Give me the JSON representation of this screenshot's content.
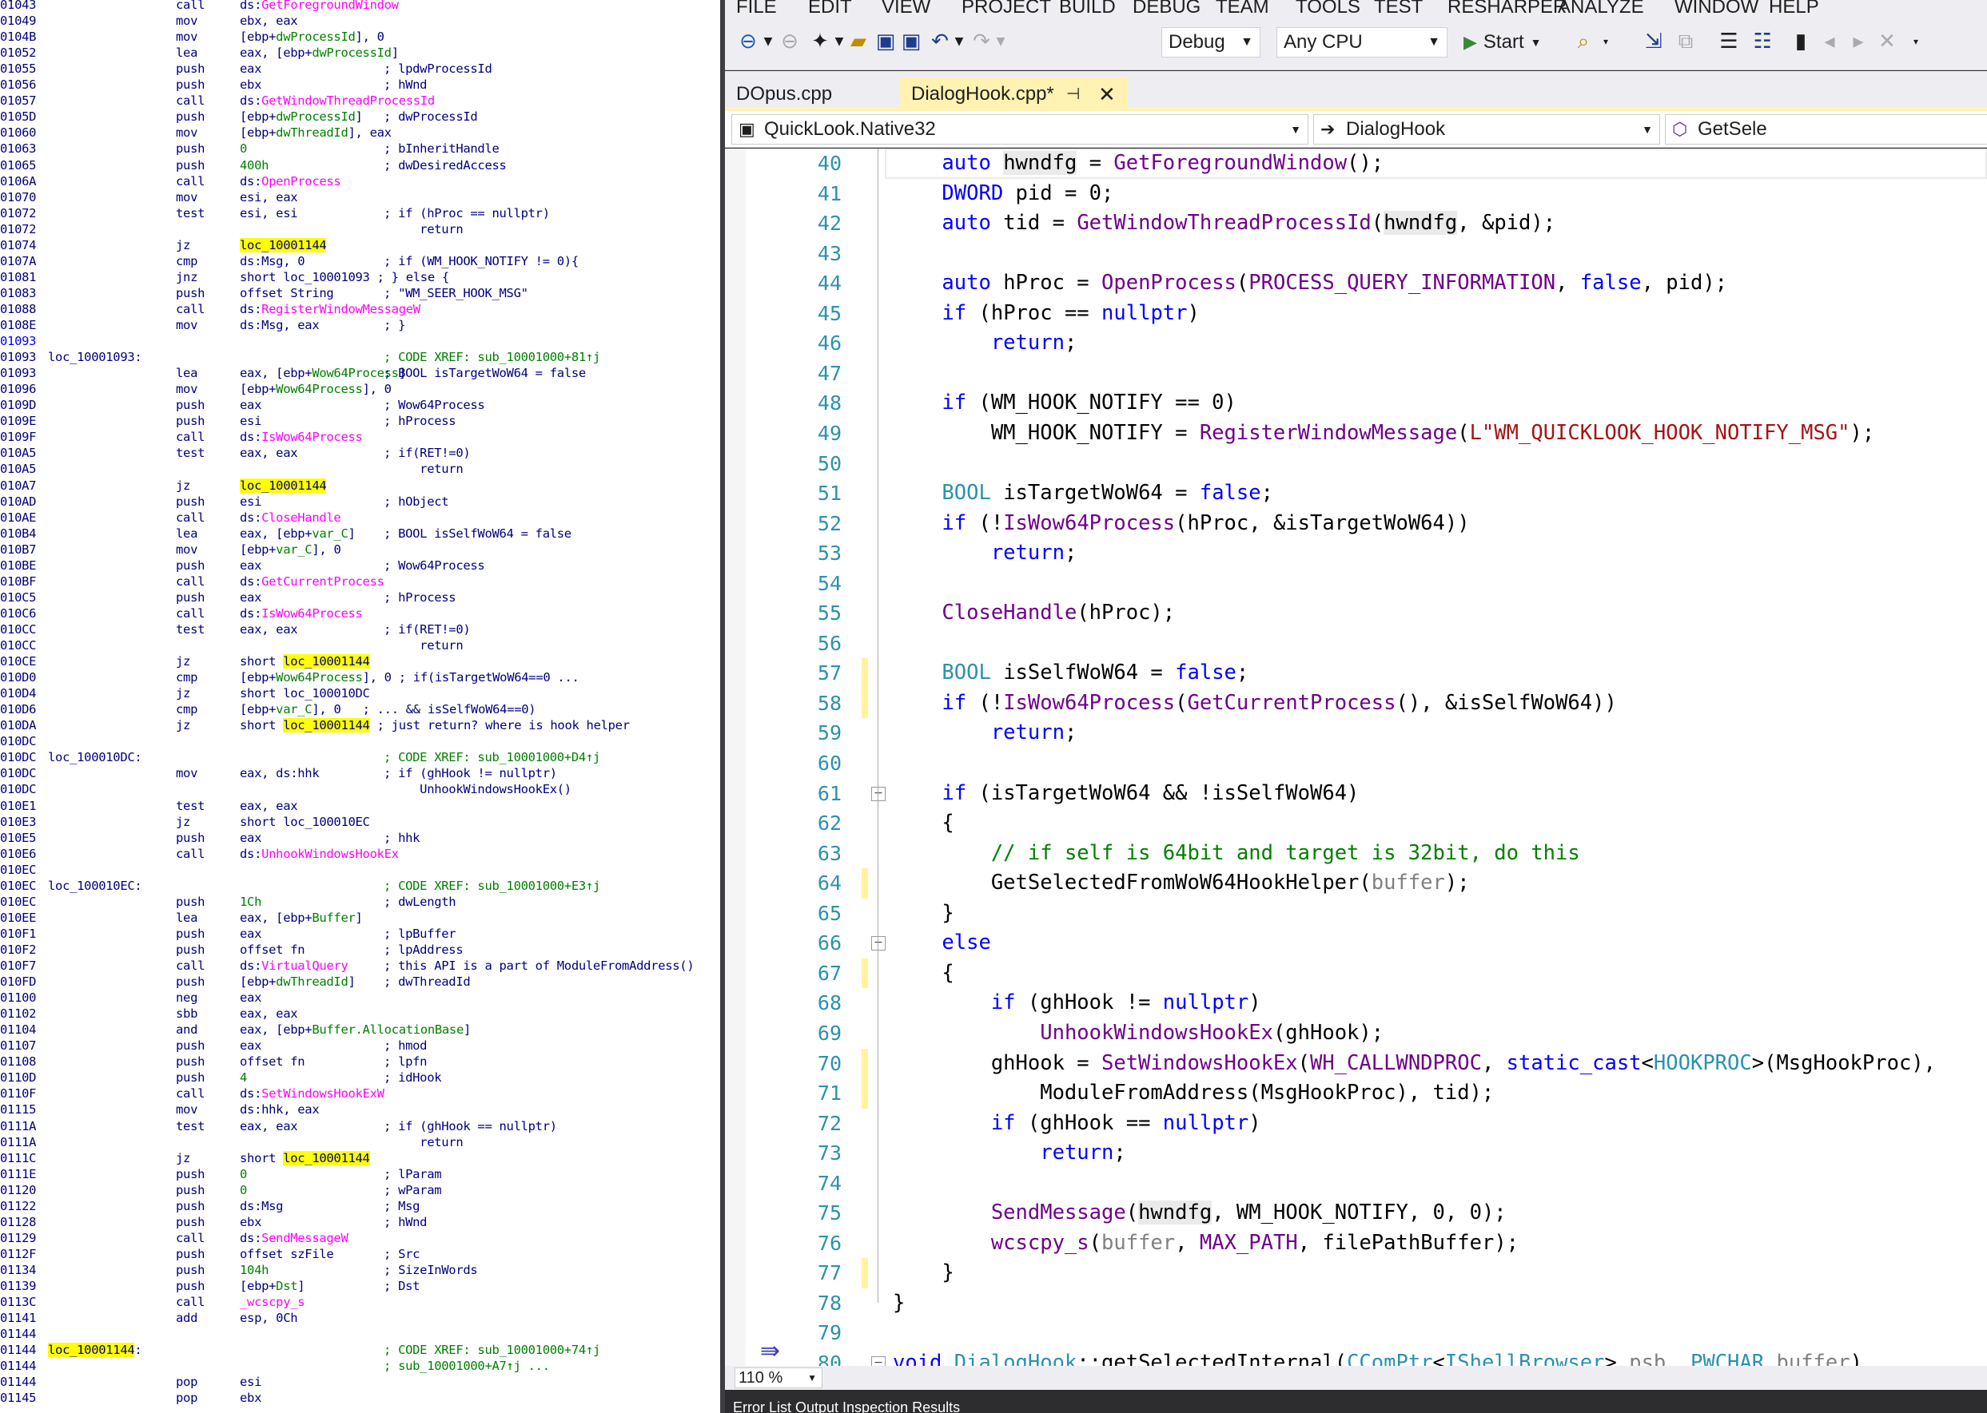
{
  "disasm": [
    [
      "01043",
      "",
      "call",
      "ds:GetForegroundWindow",
      "",
      "api"
    ],
    [
      "01049",
      "",
      "mov",
      "ebx, eax",
      "",
      ""
    ],
    [
      "0104B",
      "",
      "mov",
      "[ebp+dwProcessId], 0",
      "",
      "var"
    ],
    [
      "01052",
      "",
      "lea",
      "eax, [ebp+dwProcessId]",
      "",
      "var"
    ],
    [
      "01055",
      "",
      "push",
      "eax",
      "; lpdwProcessId",
      ""
    ],
    [
      "01056",
      "",
      "push",
      "ebx",
      "; hWnd",
      ""
    ],
    [
      "01057",
      "",
      "call",
      "ds:GetWindowThreadProcessId",
      "",
      "api"
    ],
    [
      "0105D",
      "",
      "push",
      "[ebp+dwProcessId]",
      "; dwProcessId",
      "var"
    ],
    [
      "01060",
      "",
      "mov",
      "[ebp+dwThreadId], eax",
      "",
      "var"
    ],
    [
      "01063",
      "",
      "push",
      "0",
      "; bInheritHandle",
      "num"
    ],
    [
      "01065",
      "",
      "push",
      "400h",
      "; dwDesiredAccess",
      "num"
    ],
    [
      "0106A",
      "",
      "call",
      "ds:OpenProcess",
      "",
      "api"
    ],
    [
      "01070",
      "",
      "mov",
      "esi, eax",
      "",
      ""
    ],
    [
      "01072",
      "",
      "test",
      "esi, esi",
      "; if (hProc == nullptr)",
      ""
    ],
    [
      "01072",
      "",
      "",
      "",
      "     return",
      ""
    ],
    [
      "01074",
      "",
      "jz",
      "loc_10001144",
      "",
      "loc"
    ],
    [
      "0107A",
      "",
      "cmp",
      "ds:Msg, 0",
      "; if (WM_HOOK_NOTIFY != 0){",
      ""
    ],
    [
      "01081",
      "",
      "jnz",
      "short loc_10001093 ; } else {",
      "",
      ""
    ],
    [
      "01083",
      "",
      "push",
      "offset String",
      "; \"WM_SEER_HOOK_MSG\"",
      ""
    ],
    [
      "01088",
      "",
      "call",
      "ds:RegisterWindowMessageW",
      "",
      "api"
    ],
    [
      "0108E",
      "",
      "mov",
      "ds:Msg, eax",
      "; }",
      ""
    ],
    [
      "01093",
      "",
      "",
      "",
      "",
      ""
    ],
    [
      "01093",
      "loc_10001093:",
      "",
      "",
      "; CODE XREF: sub_10001000+81↑j",
      ""
    ],
    [
      "01093",
      "",
      "lea",
      "eax, [ebp+Wow64Process]",
      "; BOOL isTargetWoW64 = false",
      "var"
    ],
    [
      "01096",
      "",
      "mov",
      "[ebp+Wow64Process], 0",
      "",
      "var"
    ],
    [
      "0109D",
      "",
      "push",
      "eax",
      "; Wow64Process",
      ""
    ],
    [
      "0109E",
      "",
      "push",
      "esi",
      "; hProcess",
      ""
    ],
    [
      "0109F",
      "",
      "call",
      "ds:IsWow64Process",
      "",
      "api"
    ],
    [
      "010A5",
      "",
      "test",
      "eax, eax",
      "; if(RET!=0)",
      ""
    ],
    [
      "010A5",
      "",
      "",
      "",
      "     return",
      ""
    ],
    [
      "010A7",
      "",
      "jz",
      "loc_10001144",
      "",
      "loc"
    ],
    [
      "010AD",
      "",
      "push",
      "esi",
      "; hObject",
      ""
    ],
    [
      "010AE",
      "",
      "call",
      "ds:CloseHandle",
      "",
      "api"
    ],
    [
      "010B4",
      "",
      "lea",
      "eax, [ebp+var_C]",
      "; BOOL isSelfWoW64 = false",
      "var"
    ],
    [
      "010B7",
      "",
      "mov",
      "[ebp+var_C], 0",
      "",
      "var"
    ],
    [
      "010BE",
      "",
      "push",
      "eax",
      "; Wow64Process",
      ""
    ],
    [
      "010BF",
      "",
      "call",
      "ds:GetCurrentProcess",
      "",
      "api"
    ],
    [
      "010C5",
      "",
      "push",
      "eax",
      "; hProcess",
      ""
    ],
    [
      "010C6",
      "",
      "call",
      "ds:IsWow64Process",
      "",
      "api"
    ],
    [
      "010CC",
      "",
      "test",
      "eax, eax",
      "; if(RET!=0)",
      ""
    ],
    [
      "010CC",
      "",
      "",
      "",
      "     return",
      ""
    ],
    [
      "010CE",
      "",
      "jz",
      "short loc_10001144",
      "",
      "sloc"
    ],
    [
      "010D0",
      "",
      "cmp",
      "[ebp+Wow64Process], 0 ; if(isTargetWoW64==0 ...",
      "",
      "var"
    ],
    [
      "010D4",
      "",
      "jz",
      "short loc_100010DC",
      "",
      ""
    ],
    [
      "010D6",
      "",
      "cmp",
      "[ebp+var_C], 0   ; ... && isSelfWoW64==0)",
      "",
      "var"
    ],
    [
      "010DA",
      "",
      "jz",
      "short loc_10001144 ; just return? where is hook helper",
      "",
      "sloc"
    ],
    [
      "010DC",
      "",
      "",
      "",
      "",
      ""
    ],
    [
      "010DC",
      "loc_100010DC:",
      "",
      "",
      "; CODE XREF: sub_10001000+D4↑j",
      ""
    ],
    [
      "010DC",
      "",
      "mov",
      "eax, ds:hhk",
      "; if (ghHook != nullptr)",
      ""
    ],
    [
      "010DC",
      "",
      "",
      "",
      "     UnhookWindowsHookEx()",
      ""
    ],
    [
      "010E1",
      "",
      "test",
      "eax, eax",
      "",
      ""
    ],
    [
      "010E3",
      "",
      "jz",
      "short loc_100010EC",
      "",
      ""
    ],
    [
      "010E5",
      "",
      "push",
      "eax",
      "; hhk",
      ""
    ],
    [
      "010E6",
      "",
      "call",
      "ds:UnhookWindowsHookEx",
      "",
      "api"
    ],
    [
      "010EC",
      "",
      "",
      "",
      "",
      ""
    ],
    [
      "010EC",
      "loc_100010EC:",
      "",
      "",
      "; CODE XREF: sub_10001000+E3↑j",
      ""
    ],
    [
      "010EC",
      "",
      "push",
      "1Ch",
      "; dwLength",
      "num"
    ],
    [
      "010EE",
      "",
      "lea",
      "eax, [ebp+Buffer]",
      "",
      "var"
    ],
    [
      "010F1",
      "",
      "push",
      "eax",
      "; lpBuffer",
      ""
    ],
    [
      "010F2",
      "",
      "push",
      "offset fn",
      "; lpAddress",
      ""
    ],
    [
      "010F7",
      "",
      "call",
      "ds:VirtualQuery",
      "; this API is a part of ModuleFromAddress()",
      "api"
    ],
    [
      "010FD",
      "",
      "push",
      "[ebp+dwThreadId]",
      "; dwThreadId",
      "var"
    ],
    [
      "01100",
      "",
      "neg",
      "eax",
      "",
      ""
    ],
    [
      "01102",
      "",
      "sbb",
      "eax, eax",
      "",
      ""
    ],
    [
      "01104",
      "",
      "and",
      "eax, [ebp+Buffer.AllocationBase]",
      "",
      "var"
    ],
    [
      "01107",
      "",
      "push",
      "eax",
      "; hmod",
      ""
    ],
    [
      "01108",
      "",
      "push",
      "offset fn",
      "; lpfn",
      ""
    ],
    [
      "0110D",
      "",
      "push",
      "4",
      "; idHook",
      "num"
    ],
    [
      "0110F",
      "",
      "call",
      "ds:SetWindowsHookExW",
      "",
      "api"
    ],
    [
      "01115",
      "",
      "mov",
      "ds:hhk, eax",
      "",
      ""
    ],
    [
      "0111A",
      "",
      "test",
      "eax, eax",
      "; if (ghHook == nullptr)",
      ""
    ],
    [
      "0111A",
      "",
      "",
      "",
      "     return",
      ""
    ],
    [
      "0111C",
      "",
      "jz",
      "short loc_10001144",
      "",
      "sloc"
    ],
    [
      "0111E",
      "",
      "push",
      "0",
      "; lParam",
      "num"
    ],
    [
      "01120",
      "",
      "push",
      "0",
      "; wParam",
      "num"
    ],
    [
      "01122",
      "",
      "push",
      "ds:Msg",
      "; Msg",
      ""
    ],
    [
      "01128",
      "",
      "push",
      "ebx",
      "; hWnd",
      ""
    ],
    [
      "01129",
      "",
      "call",
      "ds:SendMessageW",
      "",
      "api"
    ],
    [
      "0112F",
      "",
      "push",
      "offset szFile",
      "; Src",
      ""
    ],
    [
      "01134",
      "",
      "push",
      "104h",
      "; SizeInWords",
      "num"
    ],
    [
      "01139",
      "",
      "push",
      "[ebp+Dst]",
      "; Dst",
      "var"
    ],
    [
      "0113C",
      "",
      "call",
      "_wcscpy_s",
      "",
      "api2"
    ],
    [
      "01141",
      "",
      "add",
      "esp, 0Ch",
      "",
      ""
    ],
    [
      "01144",
      "",
      "",
      "",
      "",
      ""
    ],
    [
      "01144",
      "loc_10001144:",
      "",
      "",
      "; CODE XREF: sub_10001000+74↑j",
      "lbl"
    ],
    [
      "01144",
      "",
      "",
      "",
      "; sub_10001000+A7↑j ...",
      ""
    ],
    [
      "01144",
      "",
      "pop",
      "esi",
      "",
      ""
    ],
    [
      "01145",
      "",
      "pop",
      "ebx",
      "",
      ""
    ]
  ],
  "menu": [
    "FILE",
    "EDIT",
    "VIEW",
    "PROJECT",
    "BUILD",
    "DEBUG",
    "TEAM",
    "TOOLS",
    "TEST",
    "RESHARPER",
    "ANALYZE",
    "WINDOW",
    "HELP"
  ],
  "toolbar": {
    "config": "Debug",
    "platform": "Any CPU",
    "start": "Start"
  },
  "tabs": {
    "tab1": "DOpus.cpp",
    "tab2": "DialogHook.cpp*"
  },
  "nav": {
    "project": "QuickLook.Native32",
    "scope": "DialogHook",
    "member": "GetSele"
  },
  "lines": [
    "40",
    "41",
    "42",
    "43",
    "44",
    "45",
    "46",
    "47",
    "48",
    "49",
    "50",
    "51",
    "52",
    "53",
    "54",
    "55",
    "56",
    "57",
    "58",
    "59",
    "60",
    "61",
    "62",
    "63",
    "64",
    "65",
    "66",
    "67",
    "68",
    "69",
    "70",
    "71",
    "72",
    "73",
    "74",
    "75",
    "76",
    "77",
    "78",
    "79",
    "80"
  ],
  "zoom": "110 %",
  "bottom": "Error List  Output  Inspection Results"
}
